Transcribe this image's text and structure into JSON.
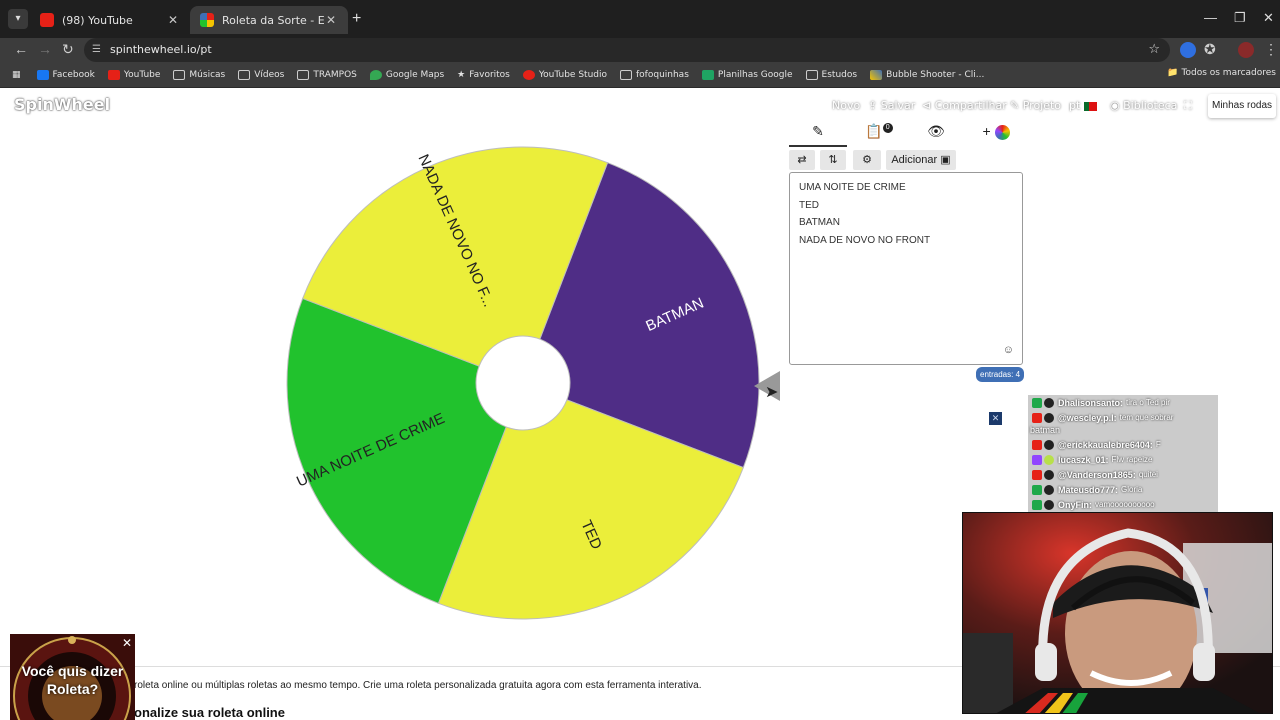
{
  "browser": {
    "tabs": [
      {
        "title": "(98) YouTube"
      },
      {
        "title": "Roleta da Sorte - Escolha Perso"
      }
    ],
    "url": "spinthewheel.io/pt",
    "bookmarks": [
      "Facebook",
      "YouTube",
      "Músicas",
      "Vídeos",
      "TRAMPOS",
      "Google Maps",
      "Favoritos",
      "YouTube Studio",
      "fofoquinhas",
      "Planilhas Google",
      "Estudos",
      "Bubble Shooter - Cli..."
    ],
    "all_bookmarks": "Todos os marcadores"
  },
  "site": {
    "logo": "SpinWheel",
    "nav": {
      "new": "Novo",
      "save": "Salvar",
      "share": "Compartilhar",
      "project": "Projeto",
      "lang": "pt",
      "library": "Biblioteca",
      "my_wheels": "Minhas rodas"
    }
  },
  "wheel": {
    "segments": [
      {
        "label": "BATMAN",
        "color": "#4f2d86"
      },
      {
        "label": "TED",
        "color": "#ebee3a"
      },
      {
        "label": "UMA NOITE DE CRIME",
        "color": "#21c22d"
      },
      {
        "label": "NADA DE NOVO NO F...",
        "color": "#ebee3a"
      }
    ]
  },
  "editor": {
    "add_button": "Adicionar",
    "entries": [
      "UMA NOITE DE CRIME",
      "TED",
      "BATMAN",
      "NADA DE NOVO NO FRONT"
    ],
    "count_label": "entradas: 4",
    "hidden_count": "0"
  },
  "footer": {
    "text": "roleta online ou múltiplas roletas ao mesmo tempo. Crie uma roleta personalizada gratuita agora com esta ferramenta interativa.",
    "heading": "onalize sua roleta online"
  },
  "chat": {
    "messages": [
      {
        "user": "Dhalisonsanto:",
        "text": "tira o Ted pir",
        "platform_color": "#1fa84a"
      },
      {
        "user": "@wescley.p.l:",
        "text": "tem que sobrar",
        "platform_color": "#e62117"
      },
      {
        "user": "@erickkaualebre6404:",
        "text": "F",
        "platform_color": "#e62117"
      },
      {
        "user": "lucaszk_01:",
        "text": "Flw rapeize",
        "platform_color": "#9146ff"
      },
      {
        "user": "@Vanderson1865:",
        "text": "quitei",
        "platform_color": "#e62117"
      },
      {
        "user": "Mateusdo777:",
        "text": "Gloria",
        "platform_color": "#1fa84a"
      },
      {
        "user": "OnyFin:",
        "text": "vamoooooooooo",
        "platform_color": "#1fa84a"
      }
    ],
    "continuation": "batman"
  },
  "promo": {
    "line1": "Você quis dizer",
    "line2": "Roleta?"
  }
}
